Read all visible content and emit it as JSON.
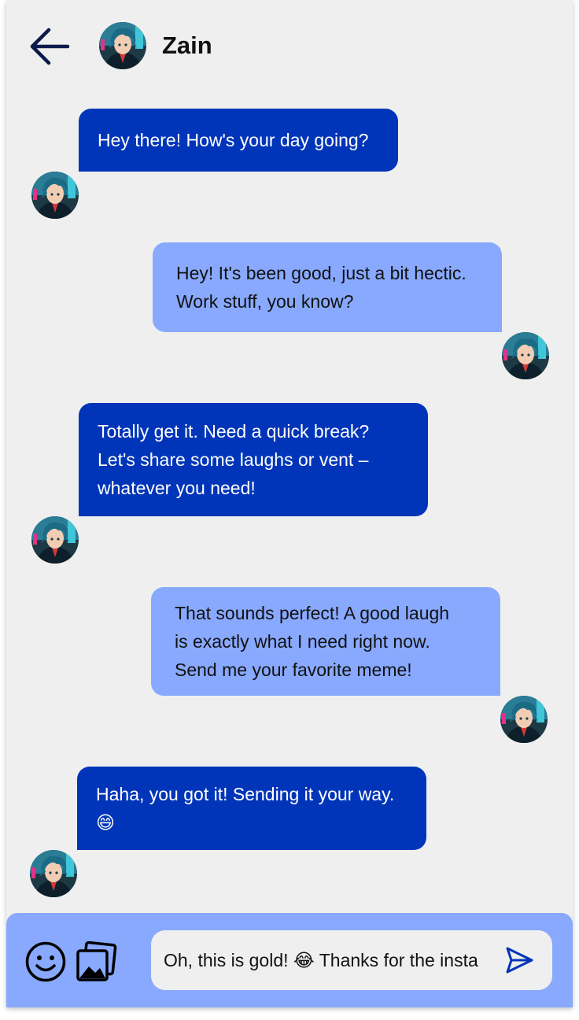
{
  "header": {
    "back_icon": "arrow-left-icon",
    "contact_name": "Zain",
    "avatar_icon": "anime-avatar"
  },
  "messages": [
    {
      "direction": "incoming",
      "lines": [
        "Hey there! How's your day going?"
      ]
    },
    {
      "direction": "outgoing",
      "lines": [
        "Hey! It's been good, just a bit hectic.",
        "Work stuff, you know?"
      ]
    },
    {
      "direction": "incoming",
      "lines": [
        "Totally get it. Need a quick break?",
        "Let's share some laughs or vent –",
        "whatever you need!"
      ]
    },
    {
      "direction": "outgoing",
      "lines": [
        "That sounds perfect! A good laugh",
        "is exactly what I need right now.",
        "Send me your favorite meme!"
      ]
    },
    {
      "direction": "incoming",
      "lines": [
        "Haha, you got it! Sending it your way.",
        "😄"
      ]
    }
  ],
  "composer": {
    "emoji_icon": "smiley-icon",
    "image_icon": "image-gallery-icon",
    "input_value": "Oh, this is gold! 😂 Thanks for the insta",
    "send_icon": "send-icon"
  },
  "colors": {
    "background": "#efefef",
    "incoming_bubble": "#0035b9",
    "outgoing_bubble": "#88a9fe",
    "composer_bar": "#88a9fe",
    "icon_dark": "#0b1a4a"
  }
}
